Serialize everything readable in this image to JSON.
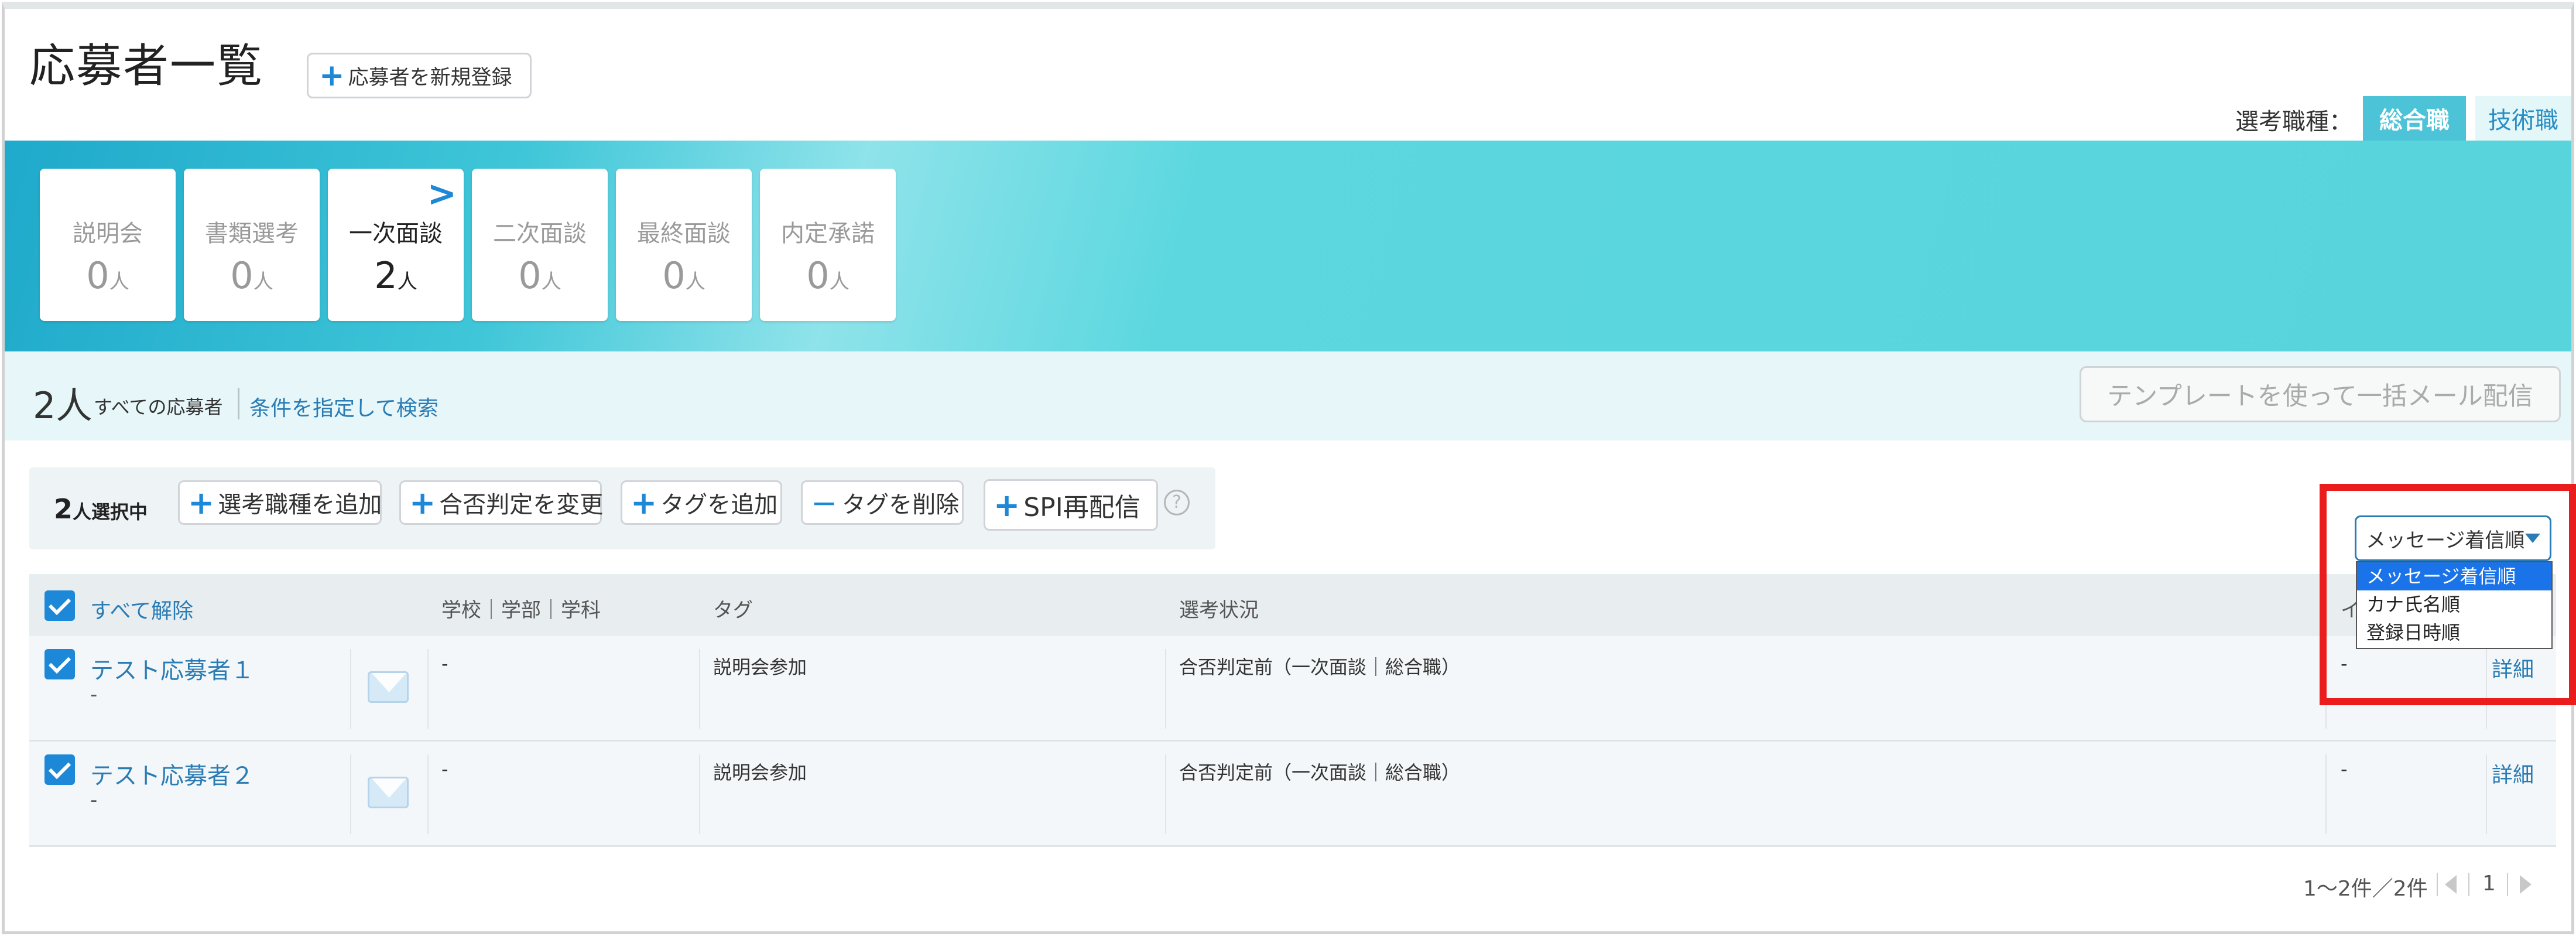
{
  "header": {
    "title": "応募者一覧",
    "new_button": "応募者を新規登録",
    "jobtype_label": "選考職種：",
    "jobtype_tabs": [
      "総合職",
      "技術職"
    ]
  },
  "stages": [
    {
      "label": "説明会",
      "count": "0",
      "unit": "人"
    },
    {
      "label": "書類選考",
      "count": "0",
      "unit": "人"
    },
    {
      "label": "一次面談",
      "count": "2",
      "unit": "人"
    },
    {
      "label": "二次面談",
      "count": "0",
      "unit": "人"
    },
    {
      "label": "最終面談",
      "count": "0",
      "unit": "人"
    },
    {
      "label": "内定承諾",
      "count": "0",
      "unit": "人"
    }
  ],
  "summary": {
    "count": "2人",
    "all_label": "すべての応募者",
    "search_link": "条件を指定して検索",
    "template_button": "テンプレートを使って一括メール配信"
  },
  "actions": {
    "selected_count": "2",
    "selected_suffix": "人選択中",
    "add_jobtype": "選考職種を追加",
    "change_result": "合否判定を変更",
    "add_tag": "タグを追加",
    "remove_tag": "タグを削除",
    "spi_resend": "SPI再配信"
  },
  "sort": {
    "selected": "メッセージ着信順",
    "options": [
      "メッセージ着信順",
      "カナ氏名順",
      "登録日時順"
    ]
  },
  "table": {
    "headers": {
      "deselect_all": "すべて解除",
      "school": "学校｜学部｜学科",
      "tag": "タグ",
      "status": "選考状況",
      "partial": "イ"
    },
    "rows": [
      {
        "name": "テスト応募者１",
        "sub": "-",
        "school": "-",
        "tag": "説明会参加",
        "status": "合否判定前（一次面談｜総合職）",
        "extra": "-",
        "detail": "詳細"
      },
      {
        "name": "テスト応募者２",
        "sub": "-",
        "school": "-",
        "tag": "説明会参加",
        "status": "合否判定前（一次面談｜総合職）",
        "extra": "-",
        "detail": "詳細"
      }
    ]
  },
  "pagination": {
    "range": "1〜2件／2件",
    "page": "1"
  },
  "colors": {
    "accent": "#1e88d8",
    "link": "#2a7cb5",
    "banner": "#4cc3d6",
    "highlight": "#ea1c1c"
  }
}
